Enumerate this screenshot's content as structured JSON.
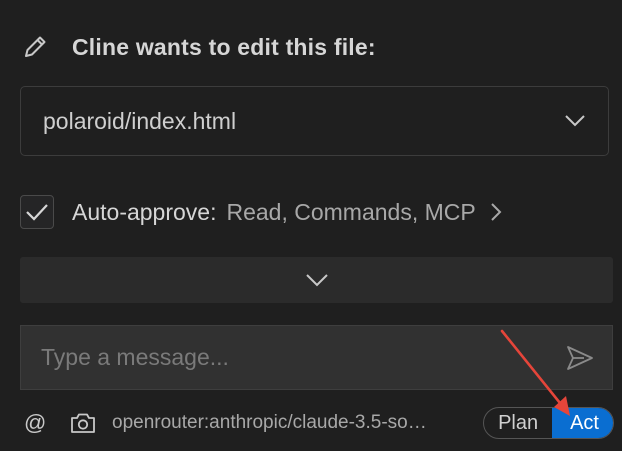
{
  "header": {
    "title": "Cline wants to edit this file:",
    "icon": "pencil-icon"
  },
  "file": {
    "path": "polaroid/index.html",
    "icon": "chevron-down-icon"
  },
  "auto_approve": {
    "checked": true,
    "label": "Auto-approve:",
    "values": "Read, Commands, MCP"
  },
  "message": {
    "placeholder": "Type a message..."
  },
  "bottom": {
    "mention": "@",
    "model": "openrouter:anthropic/claude-3.5-so…",
    "modes": {
      "plan": "Plan",
      "act": "Act",
      "active": "act"
    }
  },
  "colors": {
    "background": "#1f1f1f",
    "accent": "#0a6ed1",
    "annotation": "#e5453a"
  }
}
